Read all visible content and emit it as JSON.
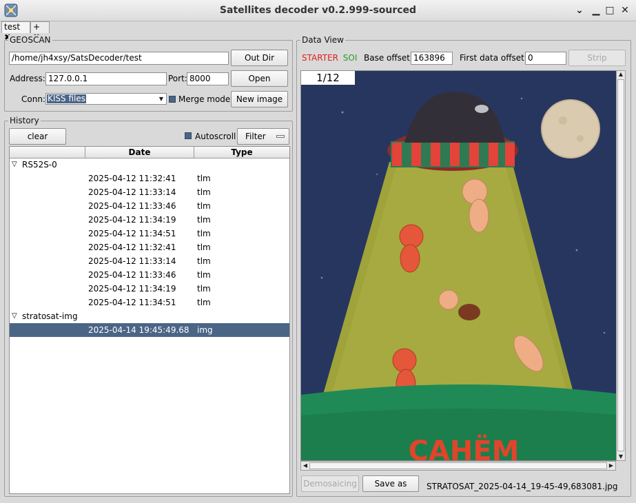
{
  "window": {
    "title": "Satellites decoder v0.2.999-sourced"
  },
  "tabs": [
    {
      "label": "test"
    },
    {
      "label": "+"
    }
  ],
  "geoscan": {
    "title": "GEOSCAN",
    "dir_value": "/home/jh4xsy/SatsDecoder/test",
    "out_dir_label": "Out Dir",
    "address_label": "Address:",
    "address_value": "127.0.0.1",
    "port_label": "Port:",
    "port_value": "8000",
    "open_label": "Open",
    "conn_label": "Conn:",
    "conn_value": "KISS files",
    "merge_label": "Merge mode",
    "new_image_label": "New image"
  },
  "history": {
    "title": "History",
    "clear_label": "clear",
    "autoscroll_label": "Autoscroll",
    "filter_label": "Filter",
    "columns": [
      "",
      "Date",
      "Type"
    ],
    "groups": [
      {
        "name": "RS52S-0",
        "rows": [
          {
            "date": "2025-04-12 11:32:41",
            "type": "tlm"
          },
          {
            "date": "2025-04-12 11:33:14",
            "type": "tlm"
          },
          {
            "date": "2025-04-12 11:33:46",
            "type": "tlm"
          },
          {
            "date": "2025-04-12 11:34:19",
            "type": "tlm"
          },
          {
            "date": "2025-04-12 11:34:51",
            "type": "tlm"
          },
          {
            "date": "2025-04-12 11:32:41",
            "type": "tlm"
          },
          {
            "date": "2025-04-12 11:33:14",
            "type": "tlm"
          },
          {
            "date": "2025-04-12 11:33:46",
            "type": "tlm"
          },
          {
            "date": "2025-04-12 11:34:19",
            "type": "tlm"
          },
          {
            "date": "2025-04-12 11:34:51",
            "type": "tlm"
          }
        ]
      },
      {
        "name": "stratosat-img",
        "rows": [
          {
            "date": "2025-04-14 19:45:49.68",
            "type": "img",
            "selected": true
          }
        ]
      }
    ]
  },
  "dataview": {
    "title": "Data View",
    "starter_label": "STARTER",
    "starter_color": "#e0201a",
    "soi_label": "SOI",
    "soi_color": "#2a9a22",
    "base_offset_label": "Base offset:",
    "base_offset_value": "163896",
    "first_offset_label": "First data offset:",
    "first_offset_value": "0",
    "strip_label": "Strip",
    "image_page": "1/12",
    "image_text": "САНЁМ",
    "demosaicing_label": "Demosaicing",
    "save_as_label": "Save as",
    "filename": "STRATOSAT_2025-04-14_19-45-49,683081.jpg"
  }
}
